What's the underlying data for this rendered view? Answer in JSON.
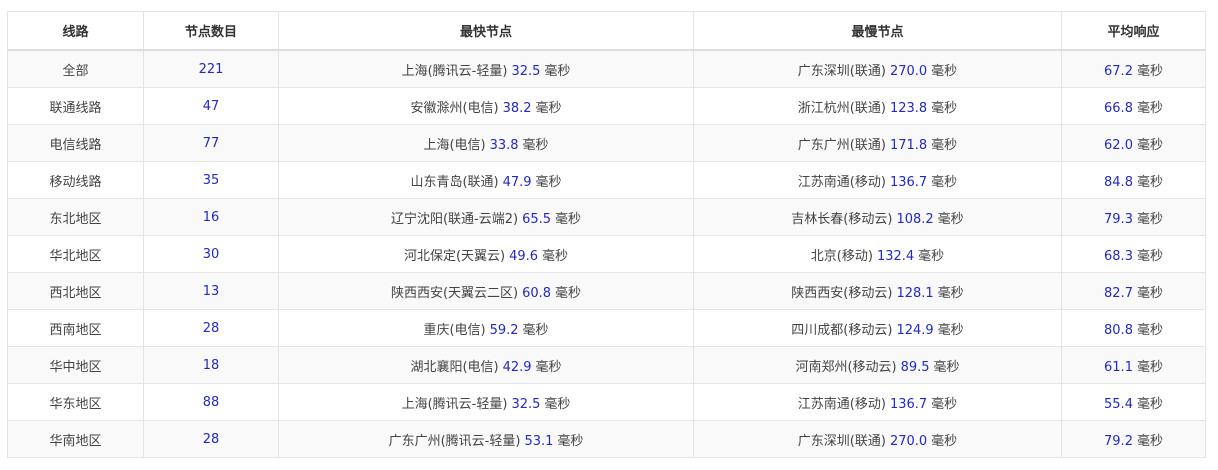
{
  "colors": {
    "value": "#2229c4",
    "text": "#444444",
    "border": "#e4e4e4",
    "stripe": "#f9f9f9"
  },
  "headers": [
    "线路",
    "节点数目",
    "最快节点",
    "最慢节点",
    "平均响应"
  ],
  "unit": "毫秒",
  "rows": [
    {
      "route": "全部",
      "count": "221",
      "fastest": {
        "name": "上海(腾讯云-轻量)",
        "value": "32.5"
      },
      "slowest": {
        "name": "广东深圳(联通)",
        "value": "270.0"
      },
      "avg": "67.2"
    },
    {
      "route": "联通线路",
      "count": "47",
      "fastest": {
        "name": "安徽滁州(电信)",
        "value": "38.2"
      },
      "slowest": {
        "name": "浙江杭州(联通)",
        "value": "123.8"
      },
      "avg": "66.8"
    },
    {
      "route": "电信线路",
      "count": "77",
      "fastest": {
        "name": "上海(电信)",
        "value": "33.8"
      },
      "slowest": {
        "name": "广东广州(联通)",
        "value": "171.8"
      },
      "avg": "62.0"
    },
    {
      "route": "移动线路",
      "count": "35",
      "fastest": {
        "name": "山东青岛(联通)",
        "value": "47.9"
      },
      "slowest": {
        "name": "江苏南通(移动)",
        "value": "136.7"
      },
      "avg": "84.8"
    },
    {
      "route": "东北地区",
      "count": "16",
      "fastest": {
        "name": "辽宁沈阳(联通-云端2)",
        "value": "65.5"
      },
      "slowest": {
        "name": "吉林长春(移动云)",
        "value": "108.2"
      },
      "avg": "79.3"
    },
    {
      "route": "华北地区",
      "count": "30",
      "fastest": {
        "name": "河北保定(天翼云)",
        "value": "49.6"
      },
      "slowest": {
        "name": "北京(移动)",
        "value": "132.4"
      },
      "avg": "68.3"
    },
    {
      "route": "西北地区",
      "count": "13",
      "fastest": {
        "name": "陕西西安(天翼云二区)",
        "value": "60.8"
      },
      "slowest": {
        "name": "陕西西安(移动云)",
        "value": "128.1"
      },
      "avg": "82.7"
    },
    {
      "route": "西南地区",
      "count": "28",
      "fastest": {
        "name": "重庆(电信)",
        "value": "59.2"
      },
      "slowest": {
        "name": "四川成都(移动云)",
        "value": "124.9"
      },
      "avg": "80.8"
    },
    {
      "route": "华中地区",
      "count": "18",
      "fastest": {
        "name": "湖北襄阳(电信)",
        "value": "42.9"
      },
      "slowest": {
        "name": "河南郑州(移动云)",
        "value": "89.5"
      },
      "avg": "61.1"
    },
    {
      "route": "华东地区",
      "count": "88",
      "fastest": {
        "name": "上海(腾讯云-轻量)",
        "value": "32.5"
      },
      "slowest": {
        "name": "江苏南通(移动)",
        "value": "136.7"
      },
      "avg": "55.4"
    },
    {
      "route": "华南地区",
      "count": "28",
      "fastest": {
        "name": "广东广州(腾讯云-轻量)",
        "value": "53.1"
      },
      "slowest": {
        "name": "广东深圳(联通)",
        "value": "270.0"
      },
      "avg": "79.2"
    }
  ]
}
